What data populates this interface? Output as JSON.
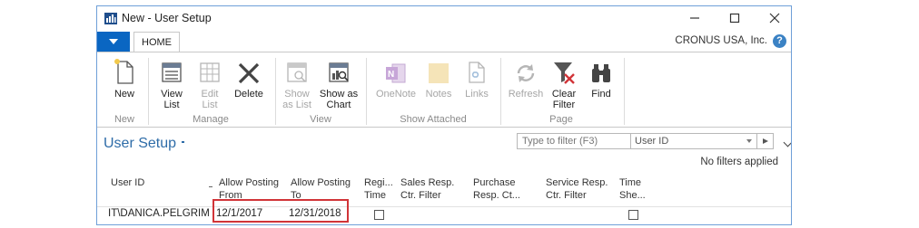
{
  "window": {
    "title": "New - User Setup"
  },
  "ribbon_tabs": {
    "home": "HOME",
    "company": "CRONUS USA, Inc.",
    "help": "?"
  },
  "groups": {
    "new": {
      "label": "New",
      "buttons": [
        {
          "label": "New"
        }
      ]
    },
    "manage": {
      "label": "Manage",
      "buttons": [
        {
          "label": "View\nList"
        },
        {
          "label": "Edit\nList",
          "disabled": true
        },
        {
          "label": "Delete"
        }
      ]
    },
    "view": {
      "label": "View",
      "buttons": [
        {
          "label": "Show\nas List",
          "disabled": true
        },
        {
          "label": "Show as\nChart"
        }
      ]
    },
    "show_attached": {
      "label": "Show Attached",
      "buttons": [
        {
          "label": "OneNote",
          "disabled": true
        },
        {
          "label": "Notes",
          "disabled": true
        },
        {
          "label": "Links",
          "disabled": true
        }
      ]
    },
    "page": {
      "label": "Page",
      "buttons": [
        {
          "label": "Refresh",
          "disabled": true
        },
        {
          "label": "Clear\nFilter"
        },
        {
          "label": "Find"
        }
      ]
    }
  },
  "page": {
    "title": "User Setup",
    "filter_placeholder": "Type to filter (F3)",
    "filter_field": "User ID",
    "no_filters": "No filters applied"
  },
  "table": {
    "columns": [
      {
        "label": "User ID"
      },
      {
        "label": "Allow Posting\nFrom"
      },
      {
        "label": "Allow Posting\nTo"
      },
      {
        "label": "Regi...\nTime"
      },
      {
        "label": "Sales Resp.\nCtr. Filter"
      },
      {
        "label": "Purchase\nResp. Ct..."
      },
      {
        "label": "Service Resp.\nCtr. Filter"
      },
      {
        "label": "Time\nShe..."
      }
    ],
    "rows": [
      {
        "user_id": "IT\\DANICA.PELGRIM",
        "from": "12/1/2017",
        "to": "12/31/2018",
        "register_time": false,
        "time_sheet": false
      }
    ]
  },
  "colors": {
    "accent": "#0a66c2",
    "title": "#2e6ca8",
    "highlight": "#d13438"
  }
}
